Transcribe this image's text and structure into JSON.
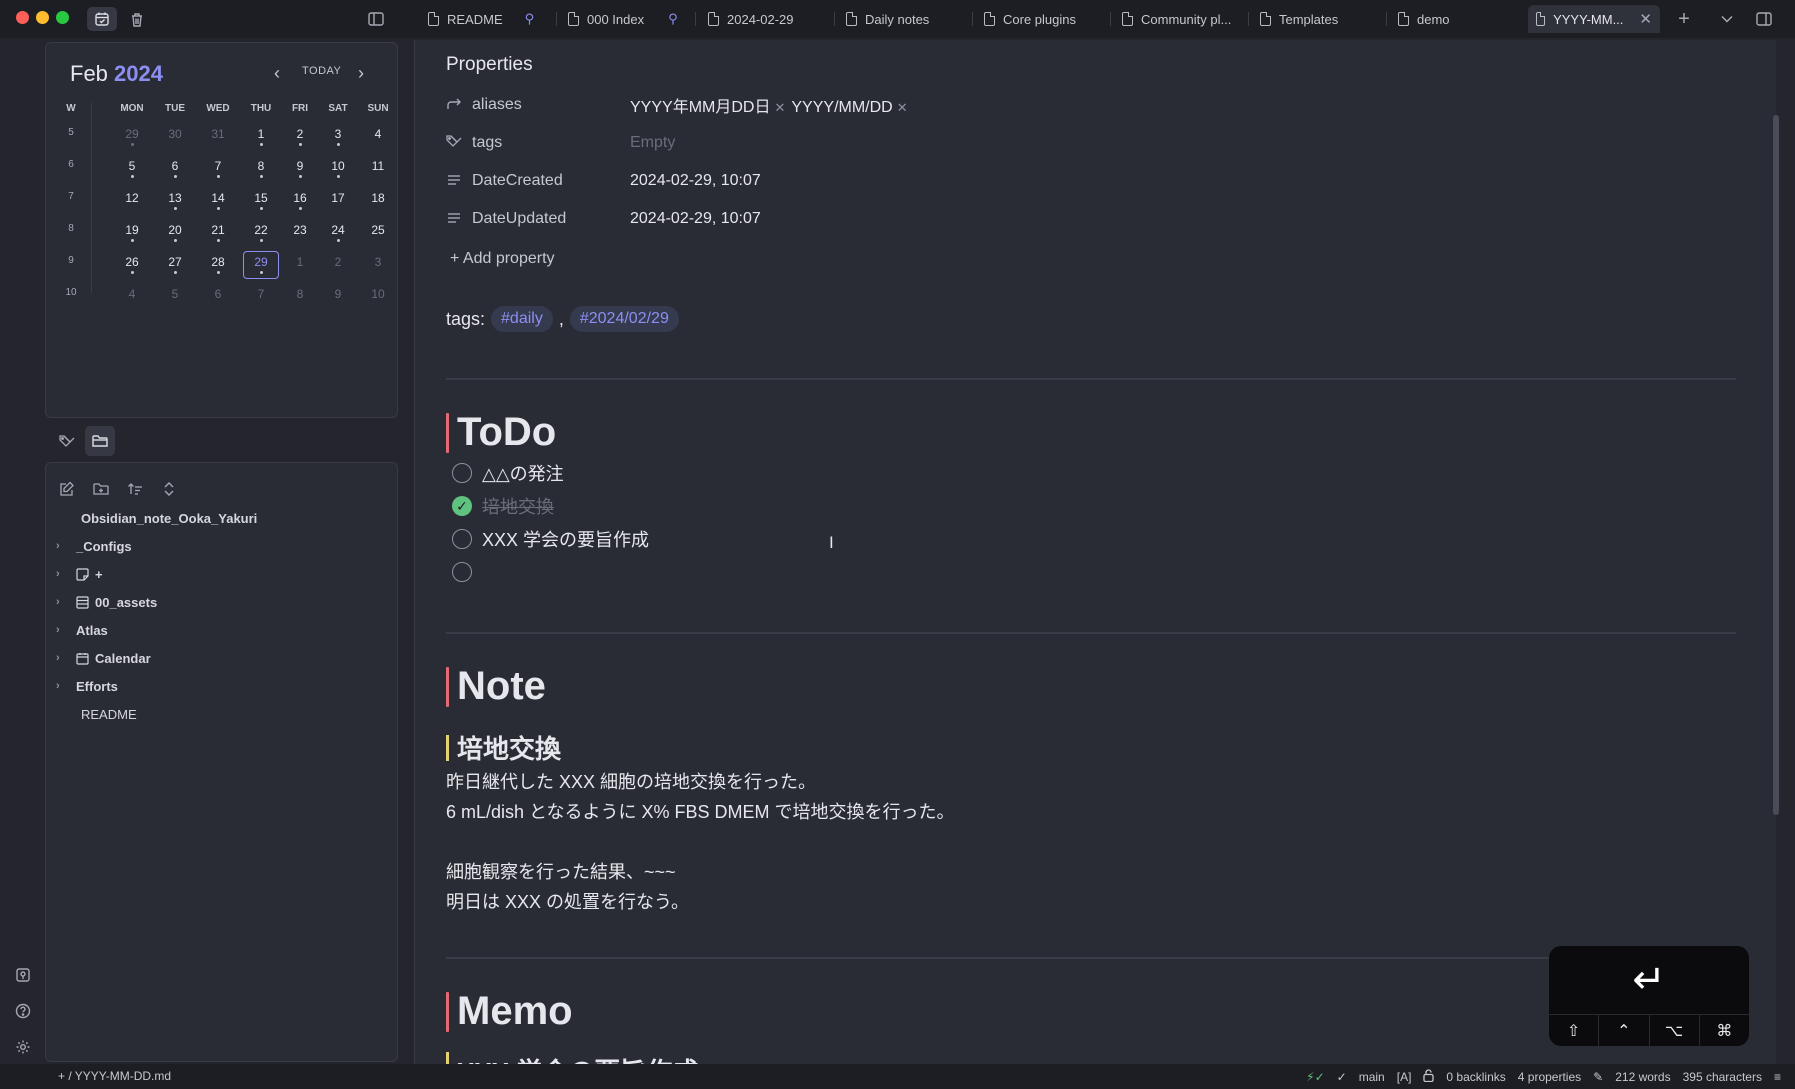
{
  "tabs": [
    {
      "label": "README",
      "pinned": true
    },
    {
      "label": "000 Index",
      "pinned": true
    },
    {
      "label": "2024-02-29"
    },
    {
      "label": "Daily notes"
    },
    {
      "label": "Core plugins"
    },
    {
      "label": "Community pl..."
    },
    {
      "label": "Templates"
    },
    {
      "label": "demo"
    },
    {
      "label": "YYYY-MM...",
      "active": true
    }
  ],
  "calendar": {
    "month": "Feb",
    "year": "2024",
    "today_label": "TODAY",
    "headers": [
      "W",
      "MON",
      "TUE",
      "WED",
      "THU",
      "FRI",
      "SAT",
      "SUN"
    ],
    "weeks": [
      {
        "w": "5",
        "days": [
          [
            "29",
            1,
            1
          ],
          [
            "30",
            1,
            0
          ],
          [
            "31",
            1,
            0
          ],
          [
            "1",
            0,
            1
          ],
          [
            "2",
            0,
            1
          ],
          [
            "3",
            0,
            1
          ],
          [
            "4",
            0,
            0
          ]
        ]
      },
      {
        "w": "6",
        "days": [
          [
            "5",
            0,
            1
          ],
          [
            "6",
            0,
            1
          ],
          [
            "7",
            0,
            1
          ],
          [
            "8",
            0,
            1
          ],
          [
            "9",
            0,
            1
          ],
          [
            "10",
            0,
            1
          ],
          [
            "11",
            0,
            0
          ]
        ]
      },
      {
        "w": "7",
        "days": [
          [
            "12",
            0,
            0
          ],
          [
            "13",
            0,
            1
          ],
          [
            "14",
            0,
            1
          ],
          [
            "15",
            0,
            1
          ],
          [
            "16",
            0,
            1
          ],
          [
            "17",
            0,
            0
          ],
          [
            "18",
            0,
            0
          ]
        ]
      },
      {
        "w": "8",
        "days": [
          [
            "19",
            0,
            1
          ],
          [
            "20",
            0,
            1
          ],
          [
            "21",
            0,
            1
          ],
          [
            "22",
            0,
            1
          ],
          [
            "23",
            0,
            0
          ],
          [
            "24",
            0,
            1
          ],
          [
            "25",
            0,
            0
          ]
        ]
      },
      {
        "w": "9",
        "days": [
          [
            "26",
            0,
            1
          ],
          [
            "27",
            0,
            1
          ],
          [
            "28",
            0,
            1
          ],
          [
            "29",
            0,
            1
          ],
          [
            "1",
            1,
            0
          ],
          [
            "2",
            1,
            0
          ],
          [
            "3",
            1,
            0
          ]
        ]
      },
      {
        "w": "10",
        "days": [
          [
            "4",
            1,
            0
          ],
          [
            "5",
            1,
            0
          ],
          [
            "6",
            1,
            0
          ],
          [
            "7",
            1,
            0
          ],
          [
            "8",
            1,
            0
          ],
          [
            "9",
            1,
            0
          ],
          [
            "10",
            1,
            0
          ]
        ]
      }
    ],
    "today": {
      "week": 4,
      "day": 3
    }
  },
  "file_tree": {
    "vault": "Obsidian_note_Ooka_Yakuri",
    "items": [
      {
        "label": "_Configs",
        "folder": true,
        "icon": ""
      },
      {
        "label": "+",
        "folder": true,
        "icon": "note-icon"
      },
      {
        "label": "00_assets",
        "folder": true,
        "icon": "table-icon"
      },
      {
        "label": "Atlas",
        "folder": true,
        "icon": ""
      },
      {
        "label": "Calendar",
        "folder": true,
        "icon": "calendar-icon"
      },
      {
        "label": "Efforts",
        "folder": true,
        "icon": ""
      },
      {
        "label": "README",
        "folder": false,
        "icon": ""
      }
    ]
  },
  "properties": {
    "title": "Properties",
    "rows": [
      {
        "key": "aliases",
        "icon": "alias-arrow-icon",
        "values": [
          "YYYY年MM月DD日",
          "YYYY/MM/DD"
        ]
      },
      {
        "key": "tags",
        "icon": "tags-icon",
        "value": "Empty",
        "empty": true
      },
      {
        "key": "DateCreated",
        "icon": "text-lines-icon",
        "value": "2024-02-29, 10:07"
      },
      {
        "key": "DateUpdated",
        "icon": "text-lines-icon",
        "value": "2024-02-29, 10:07"
      }
    ],
    "add_label": "Add property"
  },
  "tags_line": {
    "label": "tags:",
    "tags": [
      "#daily",
      "#2024/02/29"
    ],
    "sep": ","
  },
  "todo": {
    "heading": "ToDo",
    "items": [
      {
        "text": "△△の発注",
        "done": false
      },
      {
        "text": "培地交換",
        "done": true
      },
      {
        "text": "XXX 学会の要旨作成",
        "done": false
      },
      {
        "text": "",
        "done": false
      }
    ]
  },
  "note": {
    "heading": "Note",
    "subheading": "培地交換",
    "lines": [
      "昨日継代した XXX 細胞の培地交換を行った。",
      "6 mL/dish となるように X% FBS DMEM で培地交換を行った。",
      "",
      "細胞観察を行った結果、~~~",
      "明日は XXX の処置を行なう。"
    ]
  },
  "memo": {
    "heading": "Memo",
    "partial_subheading": "XXX 学会の要旨作成"
  },
  "keyboard": {
    "keys": [
      "⇧",
      "⌃",
      "⌥",
      "⌘"
    ],
    "enter": "↵"
  },
  "statusbar": {
    "path": "+ / YYYY-MM-DD.md",
    "branch": "main",
    "mode": "[A]",
    "backlinks": "0 backlinks",
    "properties": "4 properties",
    "words": "212 words",
    "characters": "395 characters"
  },
  "colors": {
    "accent": "#8c8ff0",
    "h1_bar": "#e46a72",
    "h2_bar": "#e6d070",
    "check": "#5fc27e"
  }
}
